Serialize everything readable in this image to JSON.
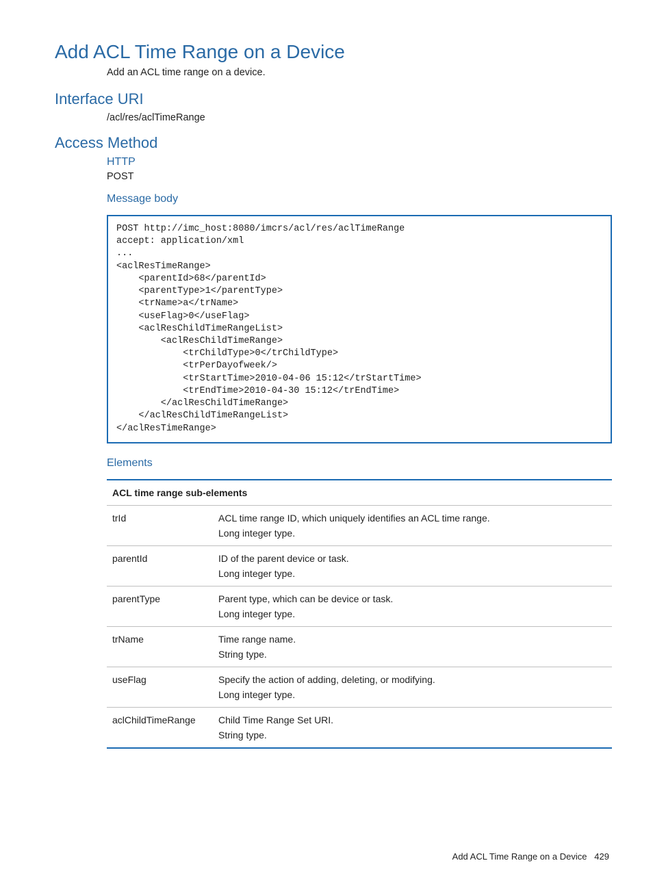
{
  "title": "Add ACL Time Range on a Device",
  "subtitle": "Add an ACL time range on a device.",
  "interface": {
    "heading": "Interface URI",
    "uri": "/acl/res/aclTimeRange"
  },
  "access": {
    "heading": "Access Method",
    "http_heading": "HTTP",
    "http_method": "POST",
    "body_heading": "Message body",
    "code": "POST http://imc_host:8080/imcrs/acl/res/aclTimeRange\naccept: application/xml\n...\n<aclResTimeRange>\n    <parentId>68</parentId>\n    <parentType>1</parentType>\n    <trName>a</trName>\n    <useFlag>0</useFlag>\n    <aclResChildTimeRangeList>\n        <aclResChildTimeRange>\n            <trChildType>0</trChildType>\n            <trPerDayofweek/>\n            <trStartTime>2010-04-06 15:12</trStartTime>\n            <trEndTime>2010-04-30 15:12</trEndTime>\n        </aclResChildTimeRange>\n    </aclResChildTimeRangeList>\n</aclResTimeRange>"
  },
  "elements": {
    "heading": "Elements",
    "table_caption": "ACL time range sub-elements",
    "rows": [
      {
        "name": "trId",
        "desc1": "ACL time range ID, which uniquely identifies an ACL time range.",
        "desc2": "Long integer type."
      },
      {
        "name": "parentId",
        "desc1": "ID of the parent device or task.",
        "desc2": "Long integer type."
      },
      {
        "name": "parentType",
        "desc1": "Parent type, which can be device or task.",
        "desc2": "Long integer type."
      },
      {
        "name": "trName",
        "desc1": "Time range name.",
        "desc2": "String type."
      },
      {
        "name": "useFlag",
        "desc1": "Specify the action of adding, deleting, or modifying.",
        "desc2": "Long integer type."
      },
      {
        "name": "aclChildTimeRange",
        "desc1": "Child Time Range Set URI.",
        "desc2": "String type."
      }
    ]
  },
  "footer": {
    "text": "Add ACL Time Range on a Device",
    "page": "429"
  }
}
